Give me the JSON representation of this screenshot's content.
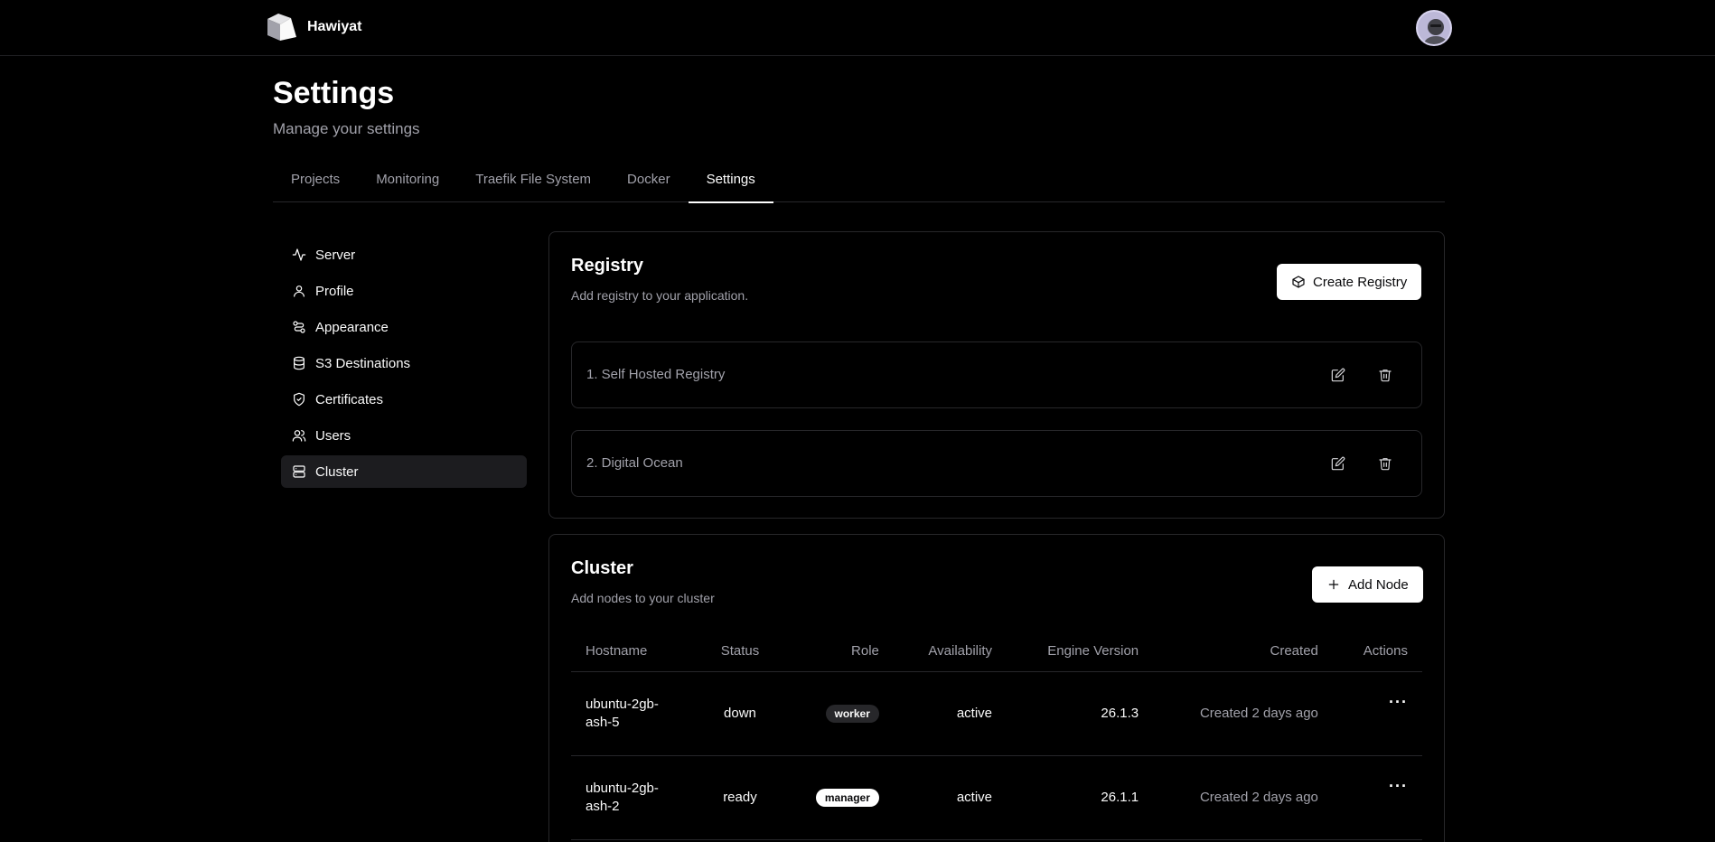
{
  "brand": {
    "name": "Hawiyat"
  },
  "header": {
    "title": "Settings",
    "subtitle": "Manage your settings"
  },
  "tabs": [
    {
      "label": "Projects"
    },
    {
      "label": "Monitoring"
    },
    {
      "label": "Traefik File System"
    },
    {
      "label": "Docker"
    },
    {
      "label": "Settings",
      "active": true
    }
  ],
  "sidebar": {
    "items": [
      {
        "label": "Server",
        "icon": "activity-icon"
      },
      {
        "label": "Profile",
        "icon": "user-icon"
      },
      {
        "label": "Appearance",
        "icon": "palette-icon"
      },
      {
        "label": "S3 Destinations",
        "icon": "database-icon"
      },
      {
        "label": "Certificates",
        "icon": "shield-check-icon"
      },
      {
        "label": "Users",
        "icon": "users-icon"
      },
      {
        "label": "Cluster",
        "icon": "server-icon",
        "active": true
      }
    ]
  },
  "registry": {
    "title": "Registry",
    "description": "Add registry to your application.",
    "create_label": "Create Registry",
    "items": [
      {
        "label": "1. Self Hosted Registry"
      },
      {
        "label": "2. Digital Ocean"
      }
    ]
  },
  "cluster": {
    "title": "Cluster",
    "description": "Add nodes to your cluster",
    "add_label": "Add Node",
    "columns": [
      "Hostname",
      "Status",
      "Role",
      "Availability",
      "Engine Version",
      "Created",
      "Actions"
    ],
    "rows": [
      {
        "hostname": "ubuntu-2gb-ash-5",
        "status": "down",
        "role": "worker",
        "availability": "active",
        "engine_version": "26.1.3",
        "created": "Created 2 days ago"
      },
      {
        "hostname": "ubuntu-2gb-ash-2",
        "status": "ready",
        "role": "manager",
        "availability": "active",
        "engine_version": "26.1.1",
        "created": "Created 2 days ago"
      }
    ],
    "actions_glyph": "···"
  },
  "colors": {
    "background": "#000000",
    "border": "#27272a",
    "muted_text": "#a1a1aa",
    "badge_dark": "#27272a",
    "badge_light": "#ffffff"
  }
}
